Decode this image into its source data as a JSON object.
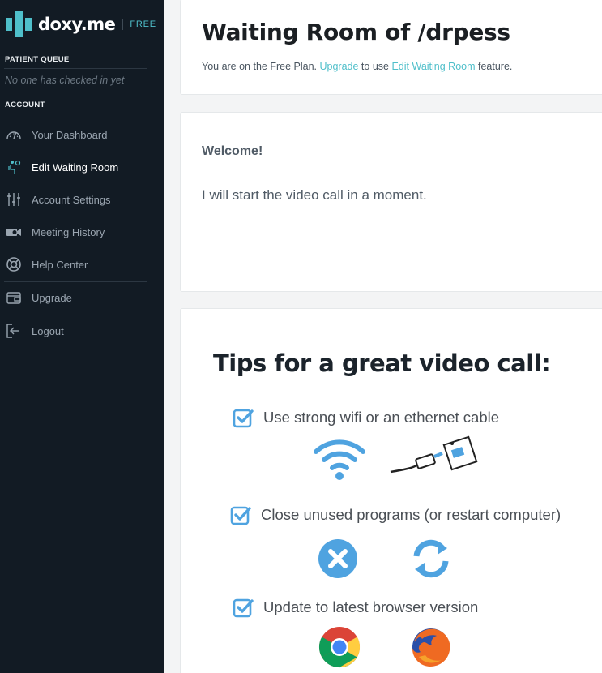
{
  "sidebar": {
    "brand_name": "doxy.me",
    "brand_plan": "FREE",
    "patient_queue_label": "PATIENT QUEUE",
    "queue_empty_text": "No one has checked in yet",
    "account_label": "ACCOUNT",
    "items": [
      {
        "label": "Your Dashboard",
        "icon": "speedometer-icon"
      },
      {
        "label": "Edit Waiting Room",
        "icon": "waiting-room-icon",
        "active": true
      },
      {
        "label": "Account Settings",
        "icon": "sliders-icon"
      },
      {
        "label": "Meeting History",
        "icon": "video-camera-icon"
      },
      {
        "label": "Help Center",
        "icon": "lifebuoy-icon"
      },
      {
        "label": "Upgrade",
        "icon": "wallet-icon"
      },
      {
        "label": "Logout",
        "icon": "logout-icon"
      }
    ]
  },
  "header": {
    "title": "Waiting Room of /drpess",
    "plan_note_prefix": "You are on the Free Plan.",
    "upgrade_link": "Upgrade",
    "plan_note_middle": "to use",
    "edit_link": "Edit Waiting Room",
    "plan_note_suffix": "feature."
  },
  "welcome_card": {
    "heading": "Welcome!",
    "message": "I will start the video call in a moment."
  },
  "tips": {
    "title": "Tips for a great video call:",
    "items": [
      {
        "text": "Use strong wifi or an ethernet cable",
        "icons": [
          "wifi-icon",
          "ethernet-cable-icon"
        ]
      },
      {
        "text": "Close unused programs (or restart computer)",
        "icons": [
          "close-circle-icon",
          "refresh-icon"
        ]
      },
      {
        "text": "Update to latest browser version",
        "icons": [
          "chrome-icon",
          "firefox-icon"
        ]
      }
    ]
  },
  "colors": {
    "sidebar_bg": "#121b24",
    "accent": "#4fbfca",
    "tip_blue": "#4fa3e0"
  }
}
